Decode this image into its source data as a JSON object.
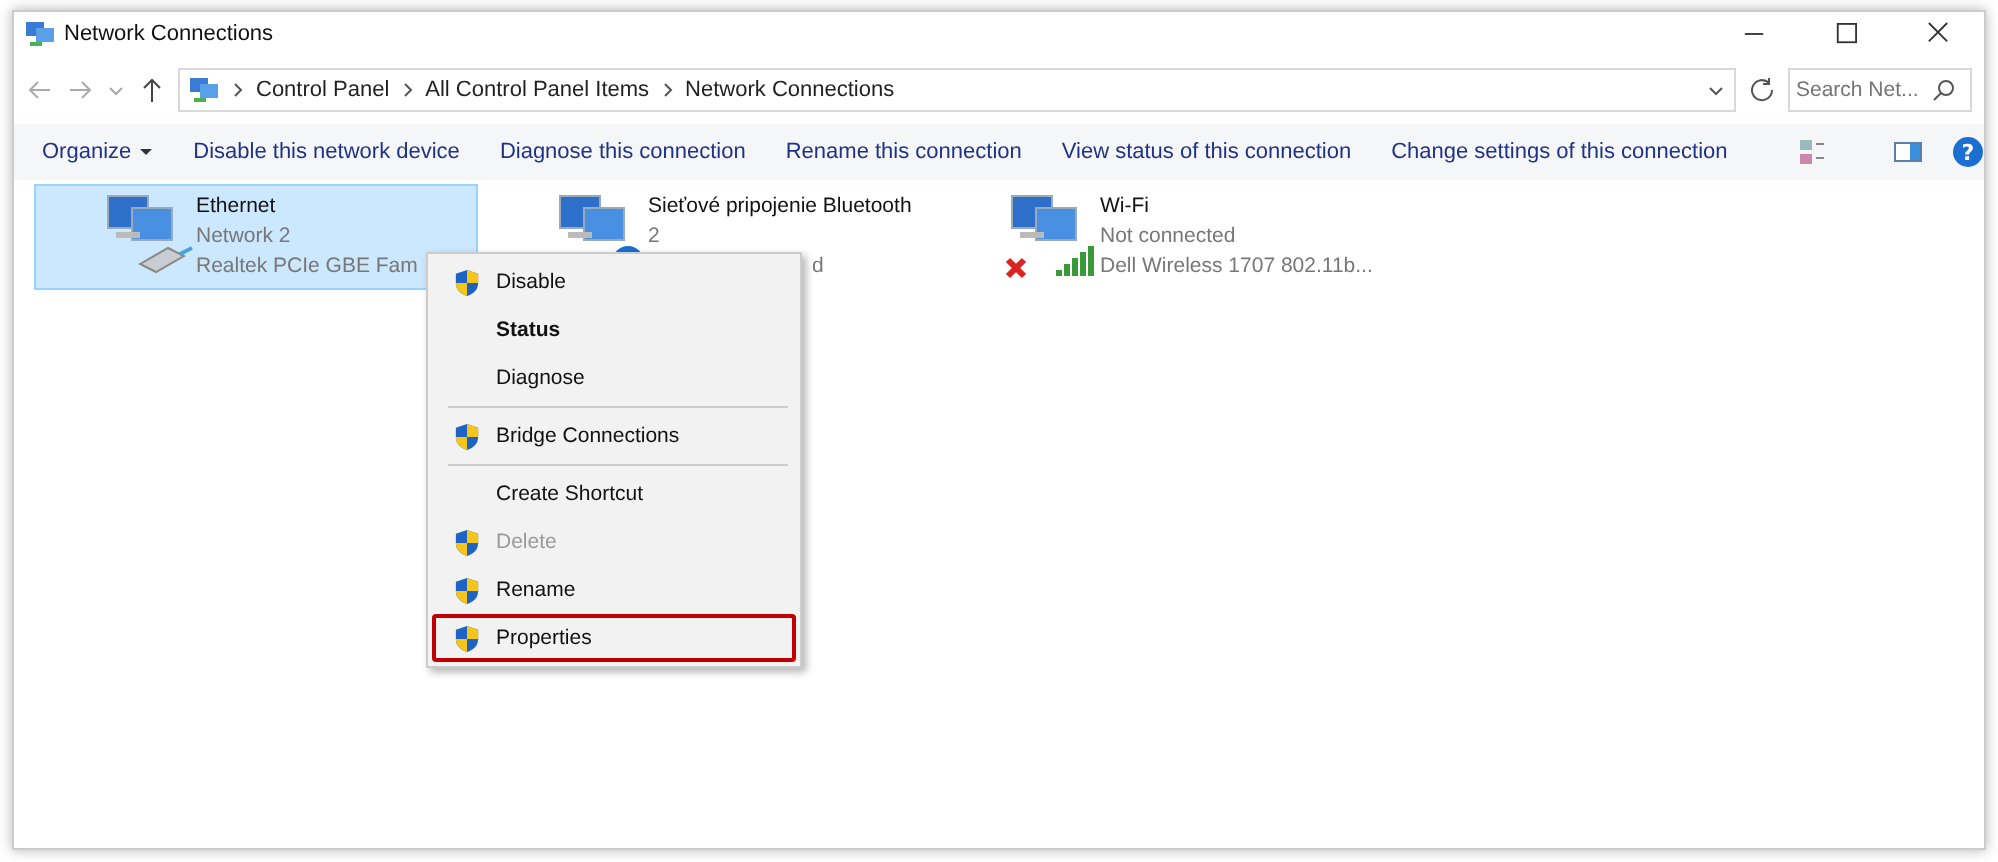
{
  "window": {
    "title": "Network Connections"
  },
  "address_bar": {
    "path": [
      "Control Panel",
      "All Control Panel Items",
      "Network Connections"
    ]
  },
  "search": {
    "placeholder": "Search Net..."
  },
  "toolbar": {
    "organize": "Organize",
    "help": "?",
    "actions": [
      "Disable this network device",
      "Diagnose this connection",
      "Rename this connection",
      "View status of this connection",
      "Change settings of this connection"
    ]
  },
  "connections": [
    {
      "kind": "ethernet",
      "name": "Ethernet",
      "status": "Network  2",
      "device": "Realtek PCIe GBE Fam",
      "selected": true
    },
    {
      "kind": "bluetooth",
      "name": "Sieťové pripojenie Bluetooth",
      "status": "2",
      "device": "d",
      "selected": false
    },
    {
      "kind": "wifi",
      "name": "Wi-Fi",
      "status": "Not connected",
      "device": "Dell Wireless 1707 802.11b...",
      "selected": false
    }
  ],
  "context_menu": [
    {
      "label": "Disable",
      "shield": true,
      "bold": false,
      "disabled": false,
      "highlighted": false,
      "separator_after": false
    },
    {
      "label": "Status",
      "shield": false,
      "bold": true,
      "disabled": false,
      "highlighted": false,
      "separator_after": false
    },
    {
      "label": "Diagnose",
      "shield": false,
      "bold": false,
      "disabled": false,
      "highlighted": false,
      "separator_after": true
    },
    {
      "label": "Bridge Connections",
      "shield": true,
      "bold": false,
      "disabled": false,
      "highlighted": false,
      "separator_after": true
    },
    {
      "label": "Create Shortcut",
      "shield": false,
      "bold": false,
      "disabled": false,
      "highlighted": false,
      "separator_after": false
    },
    {
      "label": "Delete",
      "shield": true,
      "bold": false,
      "disabled": true,
      "highlighted": false,
      "separator_after": false
    },
    {
      "label": "Rename",
      "shield": true,
      "bold": false,
      "disabled": false,
      "highlighted": false,
      "separator_after": false
    },
    {
      "label": "Properties",
      "shield": true,
      "bold": false,
      "disabled": false,
      "highlighted": true,
      "separator_after": false
    }
  ]
}
